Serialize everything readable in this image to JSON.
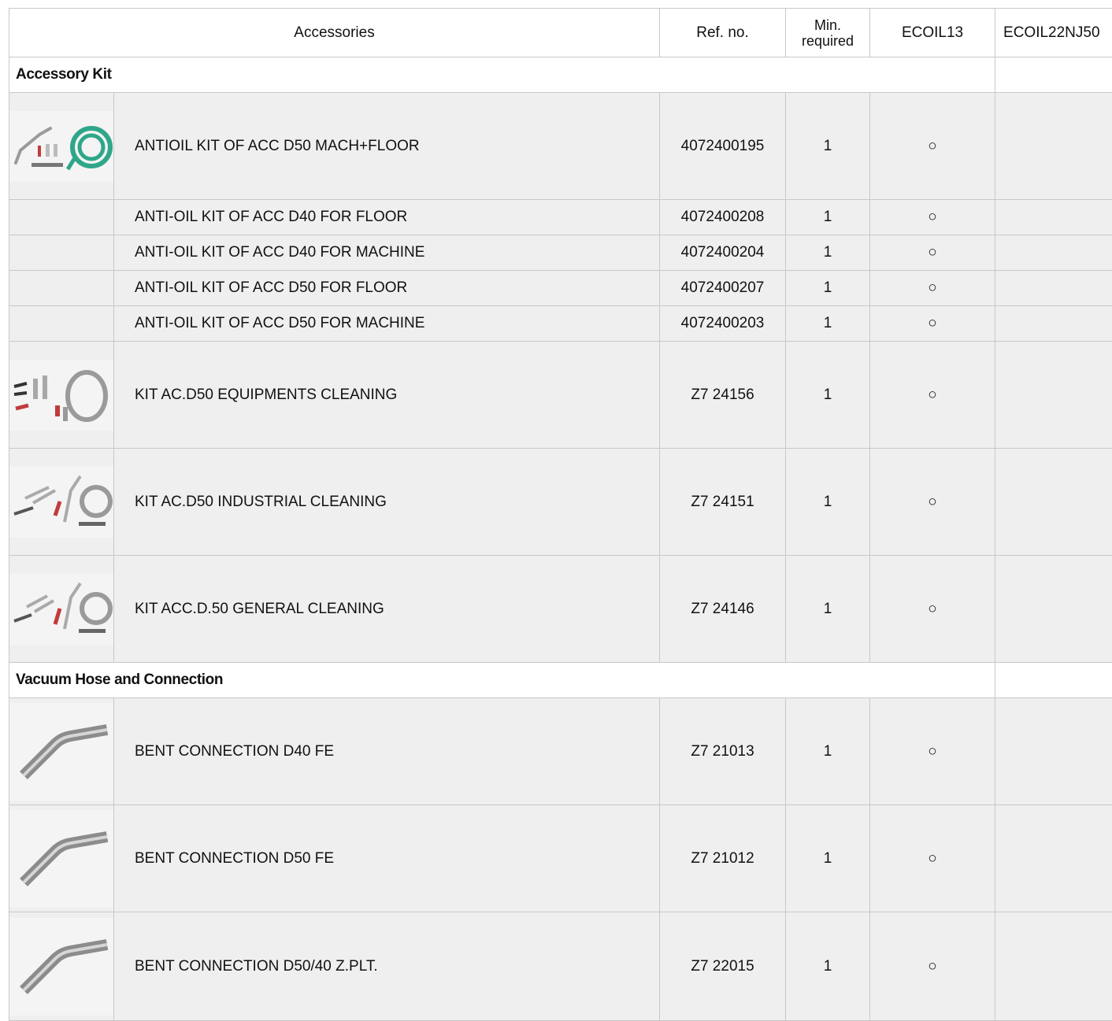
{
  "columns": {
    "accessories": "Accessories",
    "ref_no": "Ref. no.",
    "min_required": "Min. required",
    "model1": "ECOIL13",
    "model2": "ECOIL22NJ50"
  },
  "sections": [
    {
      "title": "Accessory Kit",
      "items": [
        {
          "image": "antioil-kit-thumb",
          "name": "ANTIOIL KIT OF ACC D50  MACH+FLOOR",
          "ref": "4072400195",
          "min": "1",
          "m1": "○",
          "m2": ""
        },
        {
          "image": "",
          "name": "ANTI-OIL KIT OF ACC D40 FOR FLOOR",
          "ref": "4072400208",
          "min": "1",
          "m1": "○",
          "m2": ""
        },
        {
          "image": "",
          "name": "ANTI-OIL KIT OF ACC D40 FOR MACHINE",
          "ref": "4072400204",
          "min": "1",
          "m1": "○",
          "m2": ""
        },
        {
          "image": "",
          "name": "ANTI-OIL KIT OF ACC D50 FOR FLOOR",
          "ref": "4072400207",
          "min": "1",
          "m1": "○",
          "m2": ""
        },
        {
          "image": "",
          "name": "ANTI-OIL KIT OF ACC D50 FOR MACHINE",
          "ref": "4072400203",
          "min": "1",
          "m1": "○",
          "m2": ""
        },
        {
          "image": "equipment-cleaning-kit-thumb",
          "name": "KIT AC.D50 EQUIPMENTS CLEANING",
          "ref": "Z7 24156",
          "min": "1",
          "m1": "○",
          "m2": ""
        },
        {
          "image": "industrial-cleaning-kit-thumb",
          "name": "KIT AC.D50 INDUSTRIAL CLEANING",
          "ref": "Z7 24151",
          "min": "1",
          "m1": "○",
          "m2": ""
        },
        {
          "image": "general-cleaning-kit-thumb",
          "name": "KIT ACC.D.50 GENERAL CLEANING",
          "ref": "Z7 24146",
          "min": "1",
          "m1": "○",
          "m2": ""
        }
      ]
    },
    {
      "title": "Vacuum Hose and Connection",
      "items": [
        {
          "image": "bent-connection-thumb",
          "name": "BENT CONNECTION D40 FE",
          "ref": "Z7 21013",
          "min": "1",
          "m1": "○",
          "m2": ""
        },
        {
          "image": "bent-connection-thumb",
          "name": "BENT CONNECTION D50 FE",
          "ref": "Z7 21012",
          "min": "1",
          "m1": "○",
          "m2": ""
        },
        {
          "image": "bent-connection-thumb",
          "name": "BENT CONNECTION D50/40 Z.PLT.",
          "ref": "Z7 22015",
          "min": "1",
          "m1": "○",
          "m2": ""
        }
      ]
    }
  ]
}
